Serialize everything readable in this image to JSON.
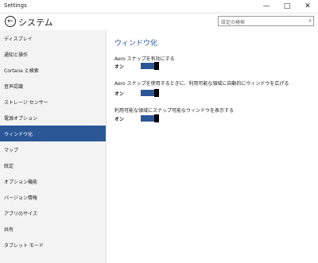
{
  "window": {
    "title": "Settings",
    "minimize": "—",
    "maximize": "□",
    "close": "✕"
  },
  "header": {
    "back_glyph": "←",
    "title": "システム",
    "search_placeholder": "設定の検索",
    "search_glyph": "⌕"
  },
  "sidebar": {
    "items": [
      {
        "label": "ディスプレイ"
      },
      {
        "label": "通知と操作"
      },
      {
        "label": "Cortana と検索"
      },
      {
        "label": "音声認識"
      },
      {
        "label": "ストレージ センサー"
      },
      {
        "label": "電源オプション"
      },
      {
        "label": "ウィンドウ化",
        "active": true
      },
      {
        "label": "マップ"
      },
      {
        "label": "既定"
      },
      {
        "label": "オプション機能"
      },
      {
        "label": "バージョン情報"
      },
      {
        "label": "アプリのサイズ"
      },
      {
        "label": "共有"
      },
      {
        "label": "タブレット モード"
      }
    ]
  },
  "content": {
    "title": "ウィンドウ化",
    "settings": [
      {
        "label": "Aero スナップを有効にする",
        "value": "オン",
        "on": true
      },
      {
        "label": "Aero スナップを使用するときに、利用可能な領域に自動的にウィンドウを広げる",
        "value": "オン",
        "on": true
      },
      {
        "label": "利用可能な領域にスナップ可能なウィンドウを表示する",
        "value": "オン",
        "on": true
      }
    ]
  }
}
